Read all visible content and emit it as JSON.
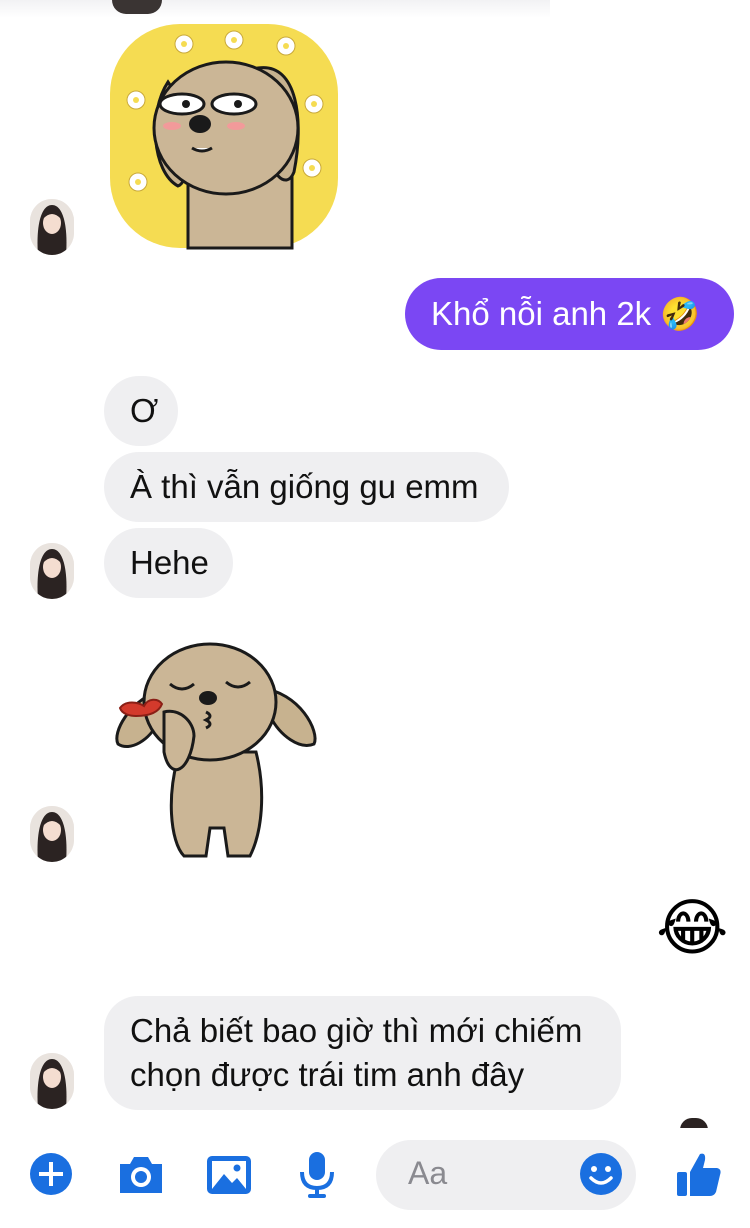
{
  "messages": {
    "outgoing_1": {
      "text": "Khổ nỗi anh 2k",
      "emoji": "🤣"
    },
    "incoming_1": "Ơ",
    "incoming_2": "À thì vẫn giống gu emm",
    "incoming_3": "Hehe",
    "outgoing_emoji": "😂",
    "incoming_4_line1": "Chả biết bao giờ thì mới chiếm",
    "incoming_4_line2": "chọn được trái tim anh đây"
  },
  "composer": {
    "placeholder": "Aa"
  },
  "colors": {
    "accent": "#7b47f3",
    "icon_blue": "#1a6fe0",
    "bubble_gray": "#efeff1",
    "sticker_yellow": "#f5dc52",
    "sticker_dog": "#cbb696"
  },
  "icons": [
    "plus-icon",
    "camera-icon",
    "image-icon",
    "microphone-icon",
    "smiley-icon",
    "thumbs-up-icon"
  ]
}
